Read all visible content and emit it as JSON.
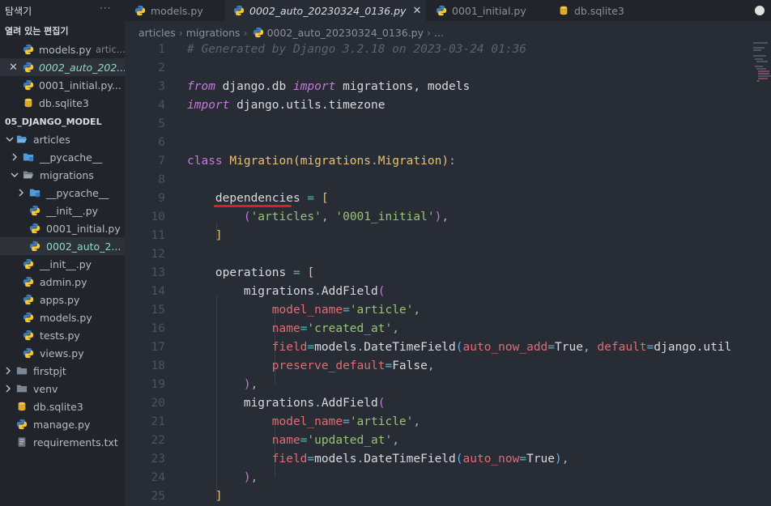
{
  "sidebar": {
    "title": "탐색기",
    "more": "···",
    "open_editors_label": "열려 있는 편집기",
    "open_editors": [
      {
        "name": "models.py",
        "hint": "artic..."
      },
      {
        "name": "0002_auto_202..."
      },
      {
        "name": "0001_initial.py..."
      },
      {
        "name": "db.sqlite3"
      }
    ],
    "project_label": "05_DJANGO_MODEL",
    "tree": [
      {
        "name": "articles"
      },
      {
        "name": "__pycache__"
      },
      {
        "name": "migrations"
      },
      {
        "name": "__pycache__"
      },
      {
        "name": "__init__.py"
      },
      {
        "name": "0001_initial.py"
      },
      {
        "name": "0002_auto_2..."
      },
      {
        "name": "__init__.py"
      },
      {
        "name": "admin.py"
      },
      {
        "name": "apps.py"
      },
      {
        "name": "models.py"
      },
      {
        "name": "tests.py"
      },
      {
        "name": "views.py"
      },
      {
        "name": "firstpjt"
      },
      {
        "name": "venv"
      },
      {
        "name": "db.sqlite3"
      },
      {
        "name": "manage.py"
      },
      {
        "name": "requirements.txt"
      }
    ]
  },
  "tabs": [
    {
      "label": "models.py",
      "active": false
    },
    {
      "label": "0002_auto_20230324_0136.py",
      "active": true,
      "close": "✕"
    },
    {
      "label": "0001_initial.py",
      "active": false
    },
    {
      "label": "db.sqlite3",
      "active": false
    }
  ],
  "breadcrumb": {
    "parts": [
      "articles",
      "migrations",
      "0002_auto_20230324_0136.py",
      "..."
    ],
    "sep": "›"
  },
  "line_numbers": [
    "1",
    "2",
    "3",
    "4",
    "5",
    "6",
    "7",
    "8",
    "9",
    "10",
    "11",
    "12",
    "13",
    "14",
    "15",
    "16",
    "17",
    "18",
    "19",
    "20",
    "21",
    "22",
    "23",
    "24",
    "25"
  ],
  "code": {
    "l1": "# Generated by Django 3.2.18 on 2023-03-24 01:36",
    "l3_from": "from",
    "l3_mod": "django.db",
    "l3_import": "import",
    "l3_names": "migrations, models",
    "l4_import": "import",
    "l4_mod": "django.utils.timezone",
    "l7_class": "class",
    "l7_name": "Migration",
    "l7_base1": "migrations",
    "l7_base2": "Migration",
    "l9_var": "dependencies",
    "l10_s1": "'articles'",
    "l10_s2": "'0001_initial'",
    "l13_var": "operations",
    "add_field_obj": "migrations",
    "add_field_fn": "AddField",
    "p_model_name": "model_name",
    "p_name": "name",
    "p_field": "field",
    "p_preserve": "preserve_default",
    "v_article": "'article'",
    "v_created": "'created_at'",
    "v_updated": "'updated_at'",
    "models": "models",
    "dtf": "DateTimeField",
    "auto_now_add": "auto_now_add",
    "auto_now": "auto_now",
    "true": "True",
    "false": "False",
    "default": "default",
    "default_val": "django.util"
  },
  "colors": {
    "accent_underline": "#e02020",
    "editor_bg": "#282c34",
    "sidebar_bg": "#21252b",
    "active_file": "#8fd8c5"
  }
}
